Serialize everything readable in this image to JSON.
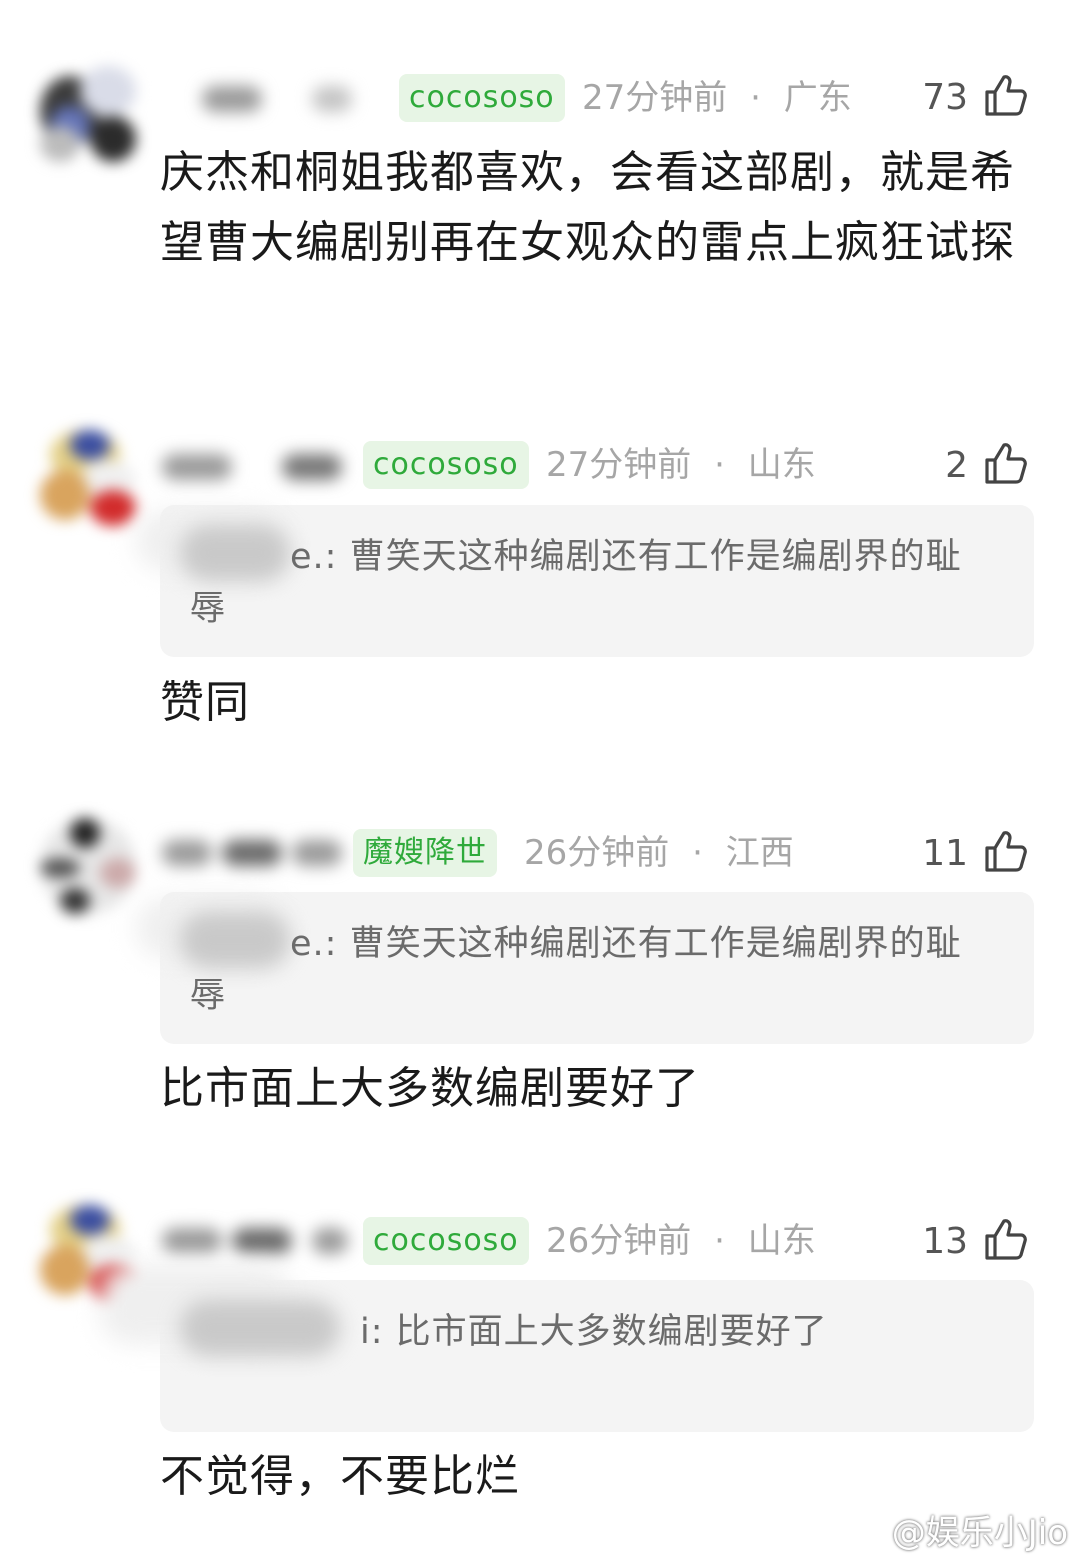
{
  "comments": [
    {
      "tag": "cocososo",
      "time": "27分钟前",
      "separator": "·",
      "location": "广东",
      "likes": "73",
      "text": "庆杰和桐姐我都喜欢，会看这部剧，就是希望曹大编剧别再在女观众的雷点上疯狂试探"
    },
    {
      "tag": "cocososo",
      "time": "27分钟前",
      "separator": "·",
      "location": "山东",
      "likes": "2",
      "quote": "e.: 曹笑天这种编剧还有工作是编剧界的耻辱",
      "text": "赞同"
    },
    {
      "tag": "魔嫂降世",
      "time": "26分钟前",
      "separator": "·",
      "location": "江西",
      "likes": "11",
      "quote": "e.: 曹笑天这种编剧还有工作是编剧界的耻辱",
      "text": "比市面上大多数编剧要好了"
    },
    {
      "tag": "cocososo",
      "time": "26分钟前",
      "separator": "·",
      "location": "山东",
      "likes": "13",
      "quote": "i: 比市面上大多数编剧要好了",
      "text": "不觉得，不要比烂"
    }
  ],
  "icons": {
    "like": "thumbs-up-icon",
    "watermark": "weibo-logo-icon"
  },
  "colors": {
    "tag_text": "#2faa3b",
    "tag_bg": "#e7f5e5",
    "meta_text": "#a6a6a6",
    "quote_bg": "#f4f4f4"
  },
  "watermark": {
    "text": "@娱乐小Jio"
  }
}
